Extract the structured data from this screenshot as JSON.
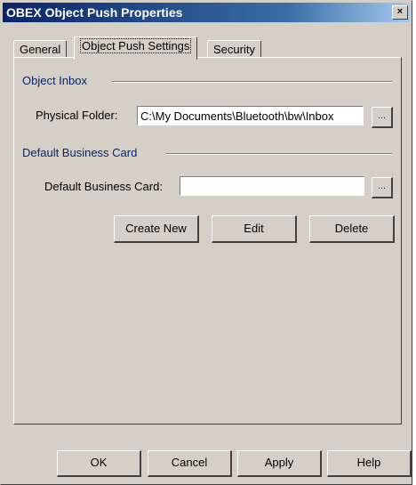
{
  "window": {
    "title": "OBEX Object Push Properties",
    "close_glyph": "×"
  },
  "tabs": [
    {
      "label": "General"
    },
    {
      "label": "Object Push Settings",
      "active": true
    },
    {
      "label": "Security"
    }
  ],
  "object_inbox": {
    "group_label": "Object Inbox",
    "folder_label": "Physical Folder:",
    "folder_value": "C:\\My Documents\\Bluetooth\\bw\\Inbox",
    "browse_label": "..."
  },
  "business_card": {
    "group_label": "Default Business Card",
    "field_label": "Default Business Card:",
    "field_value": "",
    "browse_label": "...",
    "create_new_label": "Create New",
    "edit_label": "Edit",
    "delete_label": "Delete"
  },
  "footer": {
    "ok_label": "OK",
    "cancel_label": "Cancel",
    "apply_label": "Apply",
    "help_label": "Help"
  },
  "colors": {
    "title_gradient_start": "#0a246a",
    "title_gradient_end": "#a6caf0",
    "face": "#d4d0c8",
    "group_label": "#0a246a"
  }
}
